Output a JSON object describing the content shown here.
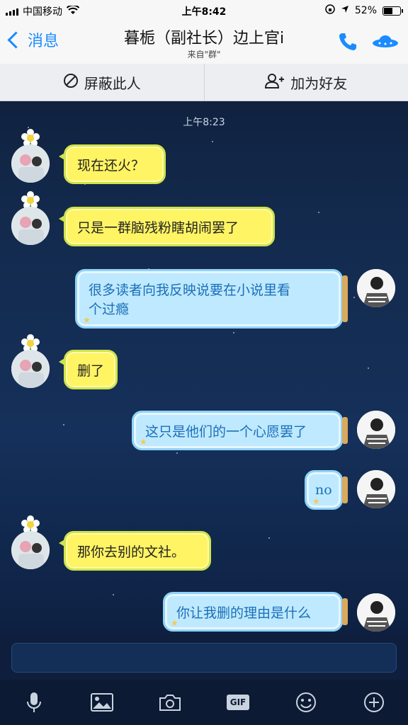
{
  "status_bar": {
    "carrier": "中国移动",
    "time": "上午8:42",
    "battery": "52%",
    "battery_level": 0.52
  },
  "nav": {
    "back_label": "消息",
    "title": "暮栀（副社长）边上官i",
    "subtitle": "来自\"群\""
  },
  "actions": {
    "block_label": "屏蔽此人",
    "add_friend_label": "加为好友"
  },
  "timestamp": "上午8:23",
  "messages": [
    {
      "side": "left",
      "text": "现在还火？"
    },
    {
      "side": "left",
      "text": "只是一群脑残粉瞎胡闹罢了"
    },
    {
      "side": "right",
      "line1": "很多读者向我反映说要在小说里看",
      "line2": "个过瘾"
    },
    {
      "side": "left",
      "text": "删了"
    },
    {
      "side": "right",
      "text": "这只是他们的一个心愿罢了"
    },
    {
      "side": "right",
      "text": "no"
    },
    {
      "side": "left",
      "text": "那你去别的文社。"
    },
    {
      "side": "right",
      "text": "你让我删的理由是什么"
    }
  ],
  "toolbar": {
    "gif_label": "GIF"
  },
  "colors": {
    "accent": "#1a8cff",
    "yellow_bubble": "#fff463",
    "blue_bubble": "#bfe9ff"
  }
}
